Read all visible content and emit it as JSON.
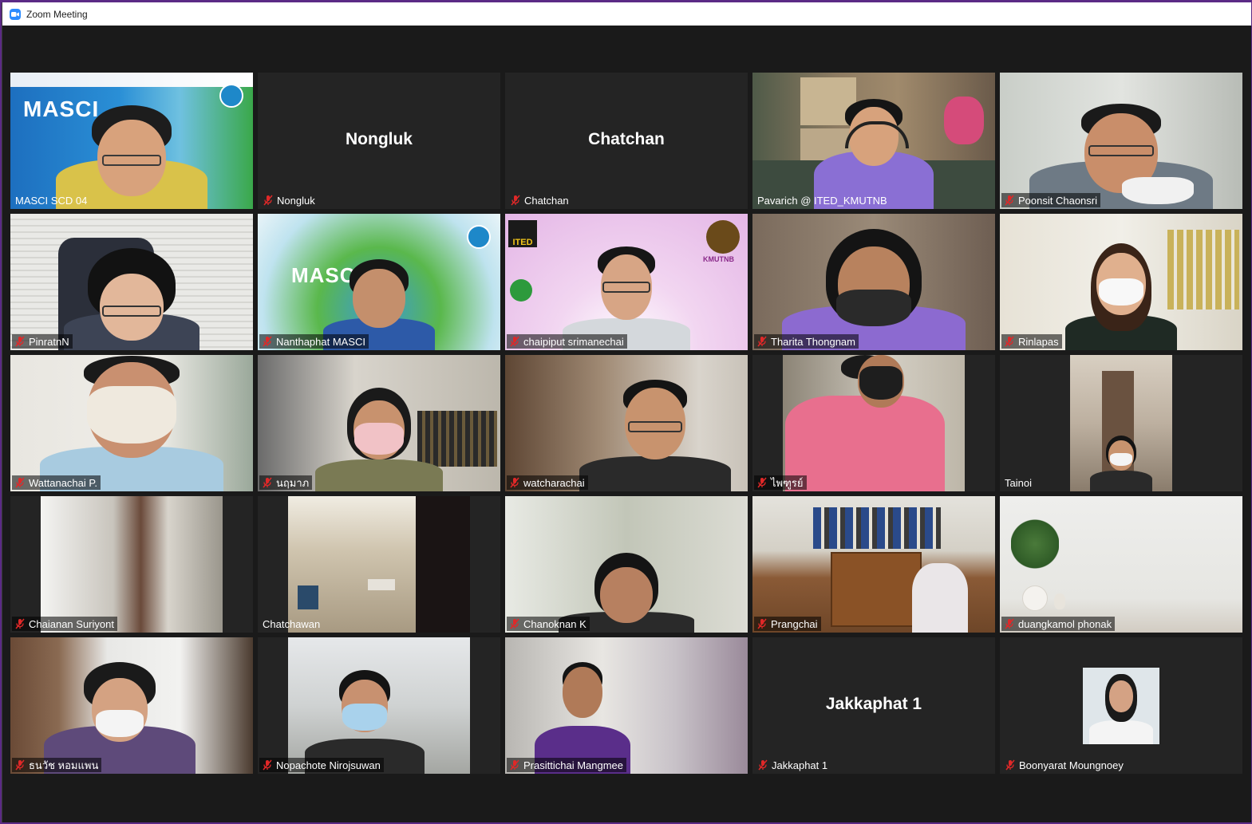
{
  "window": {
    "title": "Zoom Meeting"
  },
  "colors": {
    "active_speaker": "#c9e84a",
    "tile_bg": "#242424",
    "muted": "#e02828"
  },
  "participants": [
    {
      "name": "MASCI SCD 04",
      "muted": false,
      "active": false
    },
    {
      "name": "Nongluk",
      "muted": true,
      "active": false,
      "center_label": "Nongluk"
    },
    {
      "name": "Chatchan",
      "muted": true,
      "active": false,
      "center_label": "Chatchan"
    },
    {
      "name": "Pavarich @ ITED_KMUTNB",
      "muted": false,
      "active": true
    },
    {
      "name": "Poonsit Chaonsri",
      "muted": true,
      "active": false
    },
    {
      "name": "PinratnN",
      "muted": true,
      "active": false
    },
    {
      "name": "Nanthaphat MASCI",
      "muted": true,
      "active": false
    },
    {
      "name": "chaipiput srimanechai",
      "muted": true,
      "active": false
    },
    {
      "name": "Tharita Thongnam",
      "muted": true,
      "active": false
    },
    {
      "name": "Rinlapas",
      "muted": true,
      "active": false
    },
    {
      "name": "Wattanachai P.",
      "muted": true,
      "active": false
    },
    {
      "name": "นฤมาภ",
      "muted": true,
      "active": false
    },
    {
      "name": "watcharachai",
      "muted": true,
      "active": false
    },
    {
      "name": "ไพฑูรย์",
      "muted": true,
      "active": false
    },
    {
      "name": "Tainoi",
      "muted": false,
      "active": false
    },
    {
      "name": "Chaianan Suriyont",
      "muted": true,
      "active": false
    },
    {
      "name": "Chatchawan",
      "muted": false,
      "active": false
    },
    {
      "name": "Chanoknan K",
      "muted": true,
      "active": false
    },
    {
      "name": "Prangchai",
      "muted": true,
      "active": false
    },
    {
      "name": "duangkamol phonak",
      "muted": true,
      "active": false
    },
    {
      "name": "ธนวัช หอมแพน",
      "muted": true,
      "active": false
    },
    {
      "name": "Nopachote Nirojsuwan",
      "muted": true,
      "active": false
    },
    {
      "name": "Prasittichai Mangmee",
      "muted": true,
      "active": false
    },
    {
      "name": "Jakkaphat 1",
      "muted": true,
      "active": false,
      "center_label": "Jakkaphat 1"
    },
    {
      "name": "Boonyarat Moungnoey",
      "muted": true,
      "active": false
    }
  ],
  "backgrounds": {
    "masci_logo": "MASCI",
    "ited_logo": "ITED",
    "kmutnb_logo": "KMUTNB"
  }
}
